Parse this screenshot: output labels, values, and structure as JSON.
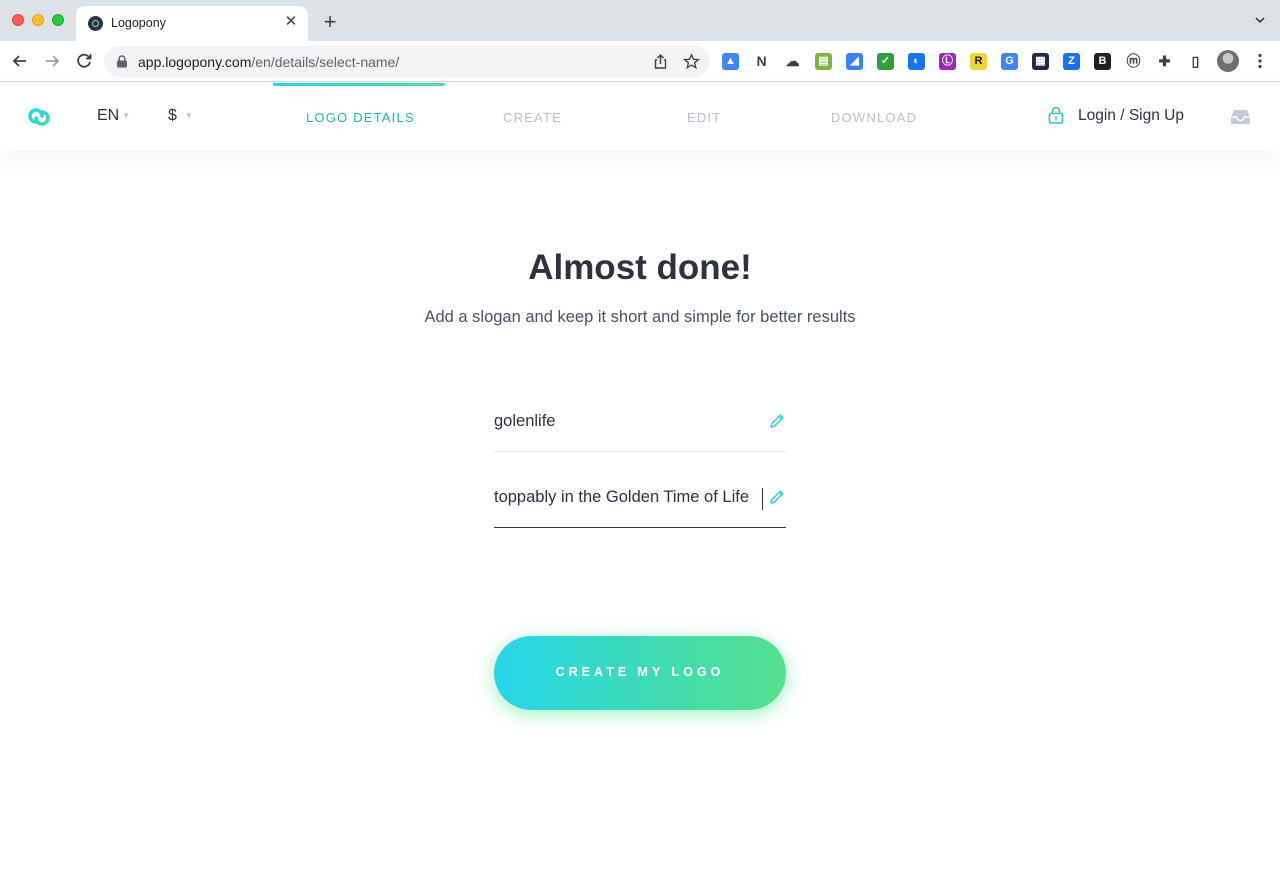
{
  "browser": {
    "tab_title": "Logopony",
    "url_host": "app.logopony.com",
    "url_path": "/en/details/select-name/",
    "extensions": [
      {
        "name": "a-icon",
        "glyph": "▲",
        "color": "#4285f4"
      },
      {
        "name": "notion-icon",
        "glyph": "N",
        "color": "#ffffff"
      },
      {
        "name": "cloud-icon",
        "glyph": "☁",
        "color": "#ffffff"
      },
      {
        "name": "printer-icon",
        "glyph": "▤",
        "color": "#7cb342"
      },
      {
        "name": "ruler-icon",
        "glyph": "◢",
        "color": "#3b82f6"
      },
      {
        "name": "check-icon",
        "glyph": "✓",
        "color": "#2e9e3e"
      },
      {
        "name": "compass-icon",
        "glyph": "◐",
        "color": "#1a73e8"
      },
      {
        "name": "lb-icon",
        "glyph": "Ⓛ",
        "color": "#9c27b0"
      },
      {
        "name": "reader-icon",
        "glyph": "R",
        "color": "#f2d23c"
      },
      {
        "name": "translate-icon",
        "glyph": "G",
        "color": "#4285f4"
      },
      {
        "name": "palette-icon",
        "glyph": "▦",
        "color": "#1e2a4a"
      },
      {
        "name": "z-icon",
        "glyph": "Z",
        "color": "#1a73e8"
      },
      {
        "name": "bookmark-icon",
        "glyph": "B",
        "color": "#202124"
      },
      {
        "name": "m-icon",
        "glyph": "ⓜ",
        "color": "#ffffff"
      },
      {
        "name": "puzzle-icon",
        "glyph": "✚",
        "color": "#ffffff"
      },
      {
        "name": "sidepanel-icon",
        "glyph": "▯",
        "color": "#ffffff"
      }
    ]
  },
  "header": {
    "language": "EN",
    "currency": "$",
    "steps": [
      "LOGO DETAILS",
      "CREATE",
      "EDIT",
      "DOWNLOAD"
    ],
    "active_step": 0,
    "login_label": "Login / Sign Up",
    "accent_color": "#1fb8a8"
  },
  "main": {
    "headline": "Almost done!",
    "subline": "Add a slogan and keep it short and simple for better results",
    "name_value": "golenlife",
    "slogan_value": "toppably in the Golden Time of Life",
    "cta_label": "CREATE MY LOGO"
  }
}
